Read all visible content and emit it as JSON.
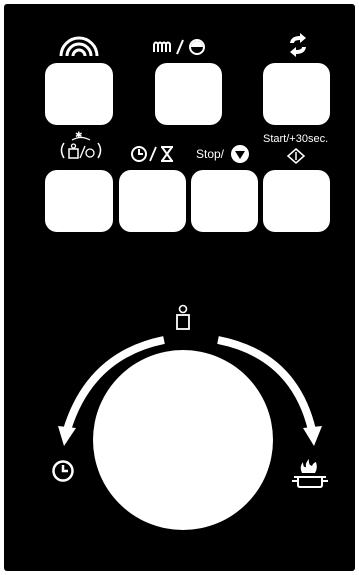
{
  "panel": {
    "row1": [
      {
        "name": "wifi-button",
        "icon": "wifi-icon"
      },
      {
        "name": "grill-microwave-button",
        "icon": "grill-fan-icon"
      },
      {
        "name": "auto-cook-button",
        "icon": "rotate-icon"
      }
    ],
    "row2": [
      {
        "name": "defrost-weight-button",
        "icon": "defrost-weight-icon"
      },
      {
        "name": "clock-timer-button",
        "icon": "clock-hourglass-icon"
      },
      {
        "name": "stop-button",
        "label": "Stop/",
        "icon": "stop-triangle-icon"
      },
      {
        "name": "start-button",
        "label": "Start/+30sec.",
        "icon": "start-diamond-icon"
      }
    ]
  },
  "dial": {
    "top_icon": "weight-icon",
    "left_icon": "clock-icon",
    "right_icon": "flame-pot-icon"
  }
}
